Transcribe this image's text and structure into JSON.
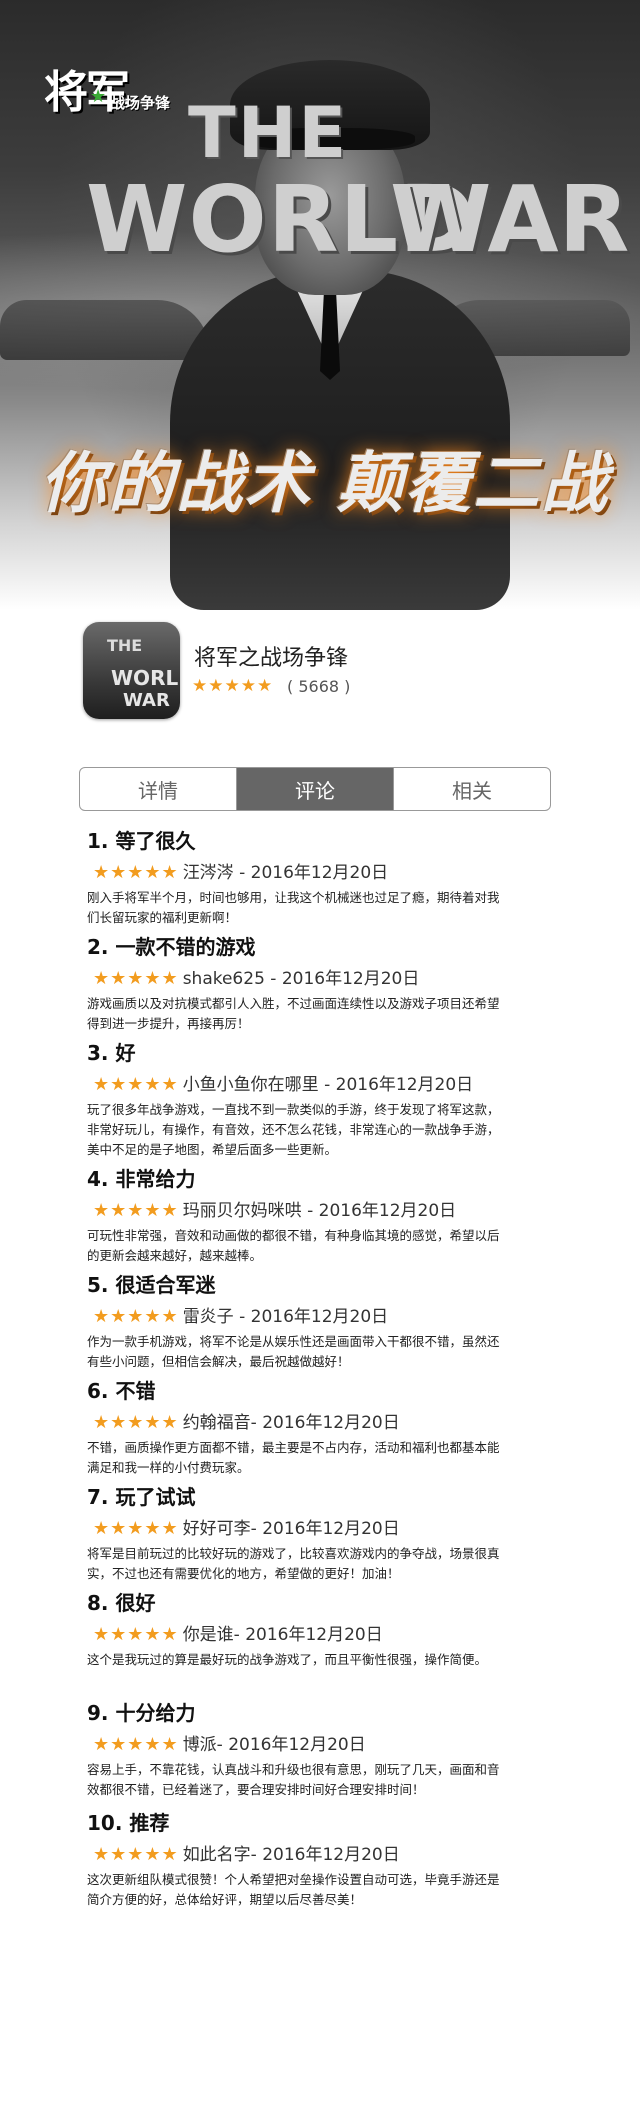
{
  "logo": {
    "main": "将军",
    "subtitle": "战场争锋"
  },
  "banner": {
    "title_line1": "THE",
    "title_word1": "WORLD",
    "title_word2": "WAR",
    "slogan": "你的战术 颠覆二战"
  },
  "app": {
    "name": "将军之战场争锋",
    "stars": "★★★★★",
    "rating_count": "( 5668 )",
    "icon_text": [
      "THE",
      "WORLD",
      "WAR"
    ]
  },
  "tabs": [
    {
      "label": "详情",
      "active": false
    },
    {
      "label": "评论",
      "active": true
    },
    {
      "label": "相关",
      "active": false
    }
  ],
  "colors": {
    "star": "#f29c1f",
    "active_tab_bg": "#666666",
    "tab_border": "#999999"
  },
  "reviews": [
    {
      "title": "1. 等了很久",
      "stars": "★★★★★",
      "meta": "汪涔涔 - 2016年12月20日",
      "body": "刚入手将军半个月，时间也够用，让我这个机械迷也过足了瘾，期待着对我们长留玩家的福利更新啊！"
    },
    {
      "title": "2. 一款不错的游戏",
      "stars": "★★★★★",
      "meta": "shake625 - 2016年12月20日",
      "body": "游戏画质以及对抗模式都引人入胜，不过画面连续性以及游戏子项目还希望得到进一步提升，再接再厉！"
    },
    {
      "title": "3. 好",
      "stars": "★★★★★",
      "meta": "小鱼小鱼你在哪里 - 2016年12月20日",
      "body": "玩了很多年战争游戏，一直找不到一款类似的手游，终于发现了将军这款，非常好玩儿，有操作，有音效，还不怎么花钱，非常连心的一款战争手游，美中不足的是子地图，希望后面多一些更新。"
    },
    {
      "title": "4. 非常给力",
      "stars": "★★★★★",
      "meta": "玛丽贝尔妈咪哄 - 2016年12月20日",
      "body": "可玩性非常强，音效和动画做的都很不错，有种身临其境的感觉，希望以后的更新会越来越好，越来越棒。"
    },
    {
      "title": "5. 很适合军迷",
      "stars": "★★★★★",
      "meta": "雷炎子 - 2016年12月20日",
      "body": "作为一款手机游戏，将军不论是从娱乐性还是画面带入干都很不错，虽然还有些小问题，但相信会解决，最后祝越做越好！"
    },
    {
      "title": "6. 不错",
      "stars": "★★★★★",
      "meta": "约翰福音- 2016年12月20日",
      "body": "不错，画质操作更方面都不错，最主要是不占内存，活动和福利也都基本能满足和我一样的小付费玩家。"
    },
    {
      "title": "7. 玩了试试",
      "stars": "★★★★★",
      "meta": "好好可李- 2016年12月20日",
      "body": "将军是目前玩过的比较好玩的游戏了，比较喜欢游戏内的争夺战，场景很真实，不过也还有需要优化的地方，希望做的更好！加油！"
    },
    {
      "title": "8. 很好",
      "stars": "★★★★★",
      "meta": "你是谁- 2016年12月20日",
      "body": "这个是我玩过的算是最好玩的战争游戏了，而且平衡性很强，操作简便。"
    },
    {
      "title": "9. 十分给力",
      "stars": "★★★★★",
      "meta": "博派- 2016年12月20日",
      "body": "容易上手，不靠花钱，认真战斗和升级也很有意思，刚玩了几天，画面和音效都很不错，已经着迷了，要合理安排时间好合理安排时间！"
    },
    {
      "title": "10. 推荐",
      "stars": "★★★★★",
      "meta": "如此名字- 2016年12月20日",
      "body": "这次更新组队模式很赞！个人希望把对垒操作设置自动可选，毕竟手游还是简介方便的好，总体给好评，期望以后尽善尽美！"
    }
  ]
}
